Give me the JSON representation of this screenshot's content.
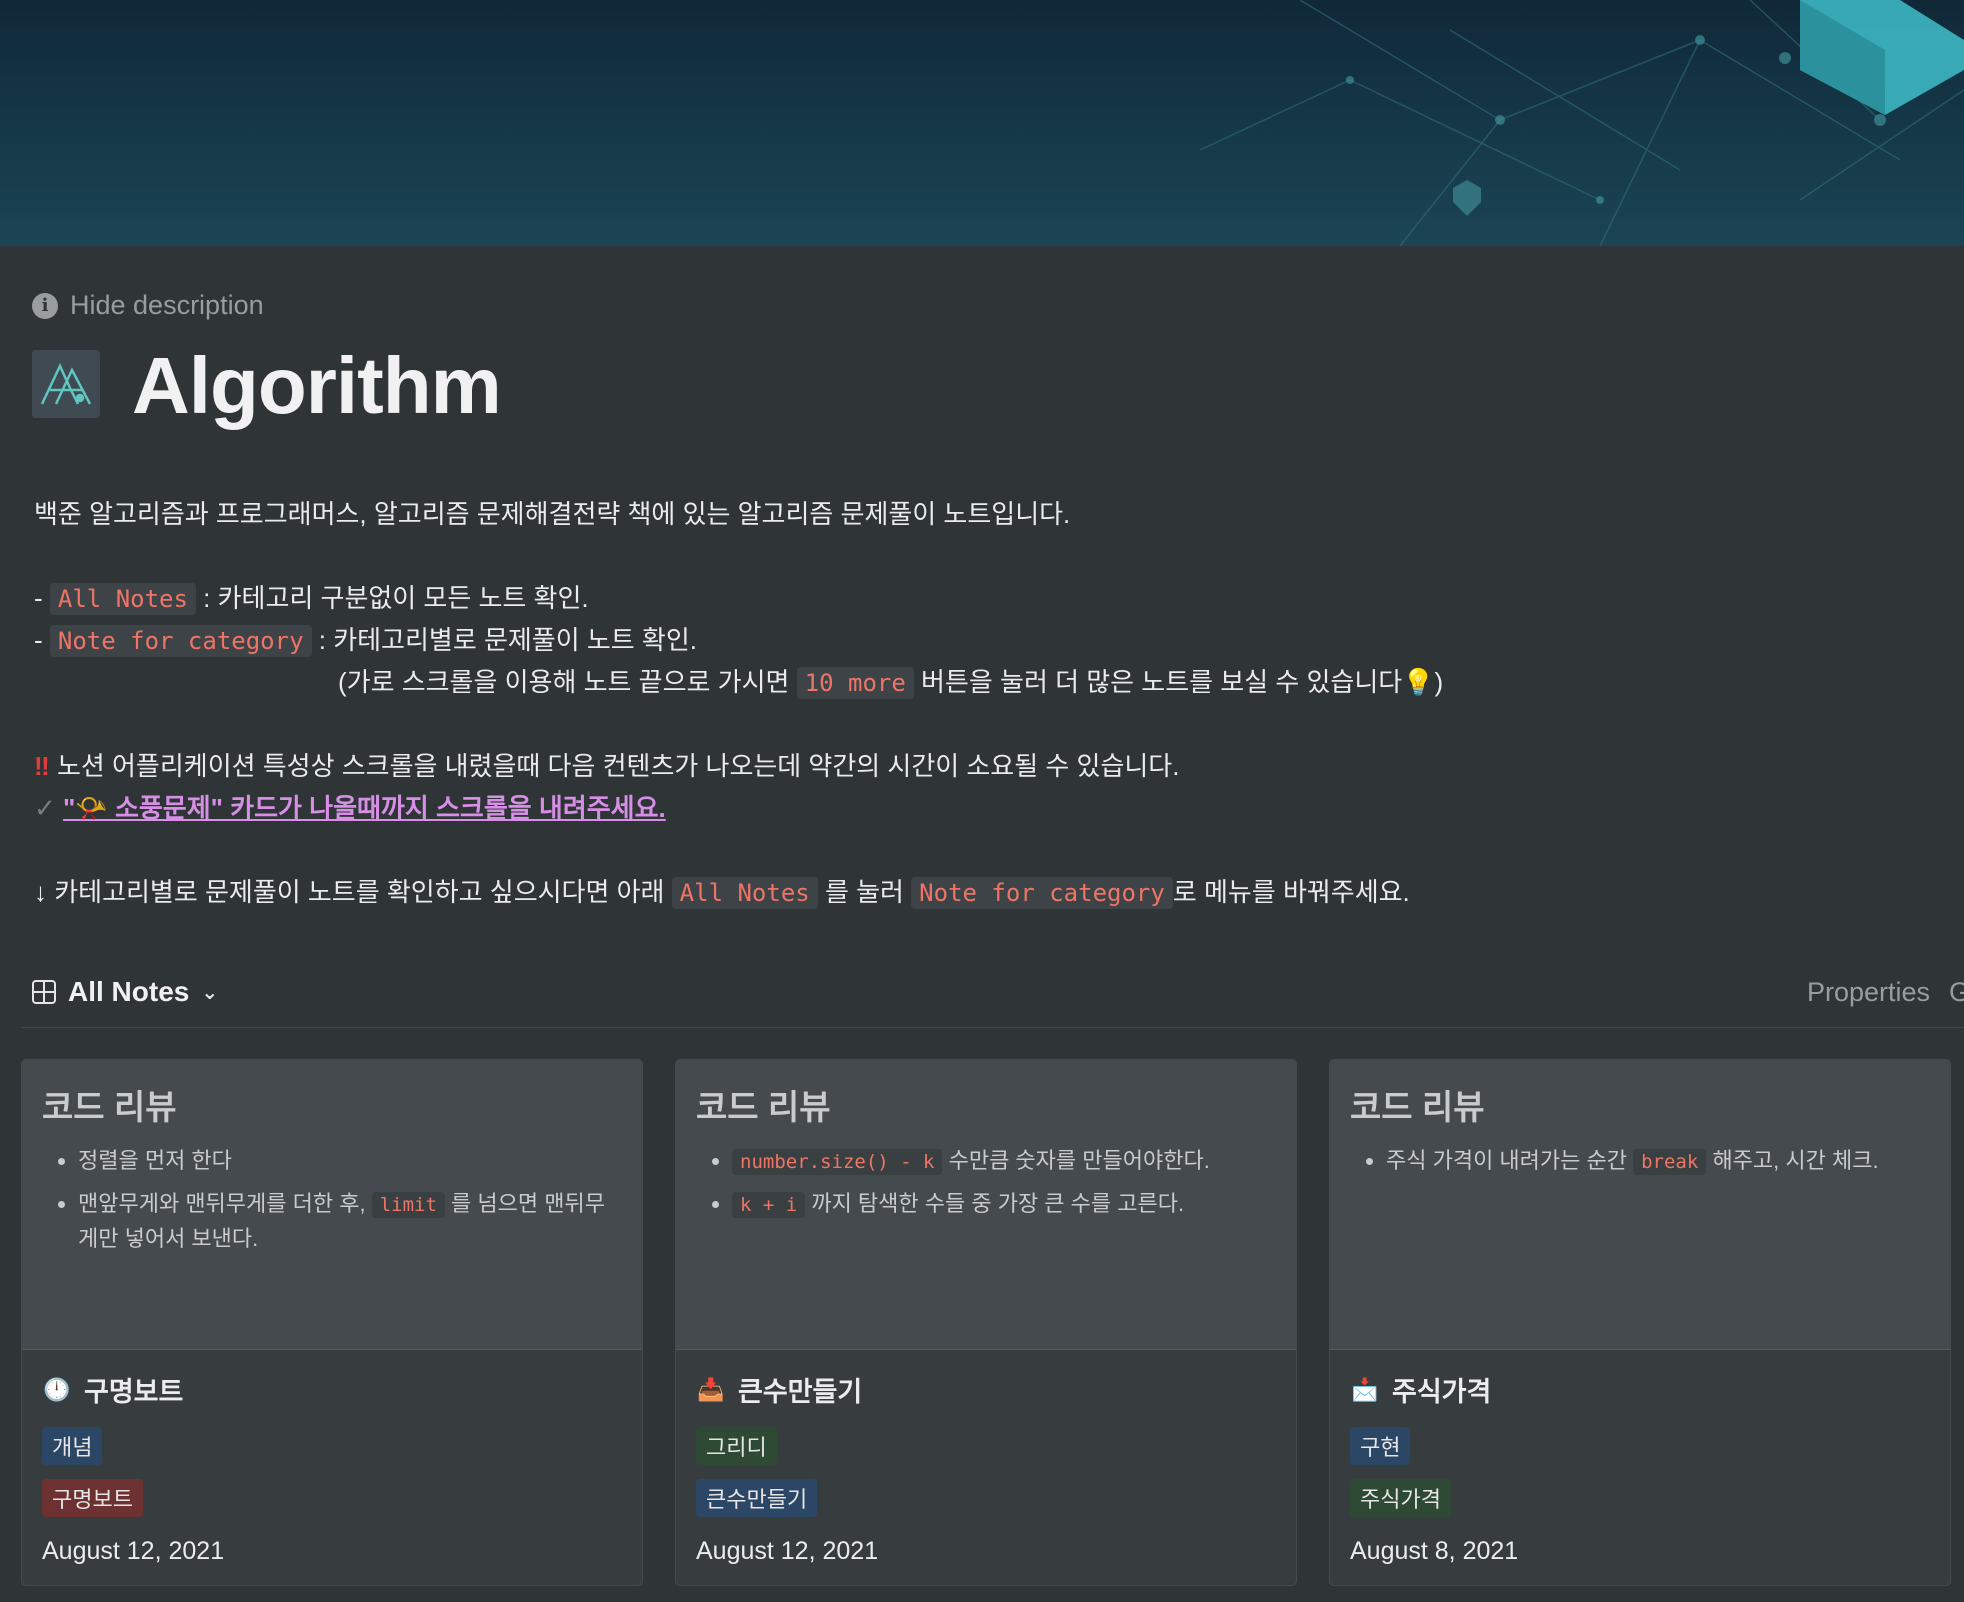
{
  "header": {
    "hide_description": "Hide description",
    "title": "Algorithm"
  },
  "description": {
    "line1": "백준 알고리즘과 프로그래머스, 알고리즘 문제해결전략 책에 있는 알고리즘 문제풀이 노트입니다.",
    "all_notes_code": "All Notes",
    "all_notes_text": ": 카테고리 구분없이 모든 노트 확인.",
    "note_cat_code": "Note for category",
    "note_cat_text": ": 카테고리별로 문제풀이 노트 확인.",
    "scroll_pre": "(가로 스크롤을 이용해 노트 끝으로 가시면",
    "more_code": "10 more",
    "scroll_post": "버튼을 눌러 더 많은 노트를 보실 수 있습니다💡)",
    "warning_mark": "‼",
    "warning_text": "노션 어플리케이션 특성상 스크롤을 내렸을때 다음 컨텐츠가 나오는데 약간의 시간이 소요될 수 있습니다.",
    "check_mark": "✓",
    "link_text": "\"📯 소풍문제\" 카드가 나올때까지 스크롤을 내려주세요.",
    "arrow": "↓",
    "bottom_pre": "카테고리별로 문제풀이 노트를 확인하고 싶으시다면 아래",
    "bottom_code1": "All Notes",
    "bottom_mid": "를 눌러",
    "bottom_code2": "Note for category",
    "bottom_post": "로 메뉴를 바꿔주세요."
  },
  "view": {
    "name": "All Notes",
    "properties": "Properties",
    "cutoff": "G"
  },
  "cards": [
    {
      "preview_title": "코드 리뷰",
      "b1": "정렬을 먼저 한다",
      "b2_pre": "맨앞무게와 맨뒤무게를 더한 후,",
      "b2_code": "limit",
      "b2_post": "를 넘으면 맨뒤무게만 넣어서 보낸다.",
      "emoji": "🕛",
      "title": "구명보트",
      "tag1": "개념",
      "tag2": "구명보트",
      "date": "August 12, 2021"
    },
    {
      "preview_title": "코드 리뷰",
      "b1_code": "number.size() - k",
      "b1_post": "수만큼 숫자를 만들어야한다.",
      "b2_code": "k + i",
      "b2_post": "까지 탐색한 수들 중 가장 큰 수를 고른다.",
      "emoji": "📥",
      "title": "큰수만들기",
      "tag1": "그리디",
      "tag2": "큰수만들기",
      "date": "August 12, 2021"
    },
    {
      "preview_title": "코드 리뷰",
      "b1_pre": "주식 가격이 내려가는 순간",
      "b1_code": "break",
      "b1_post": "해주고, 시간 체크.",
      "emoji": "📩",
      "title": "주식가격",
      "tag1": "구현",
      "tag2": "주식가격",
      "date": "August 8, 2021"
    }
  ]
}
